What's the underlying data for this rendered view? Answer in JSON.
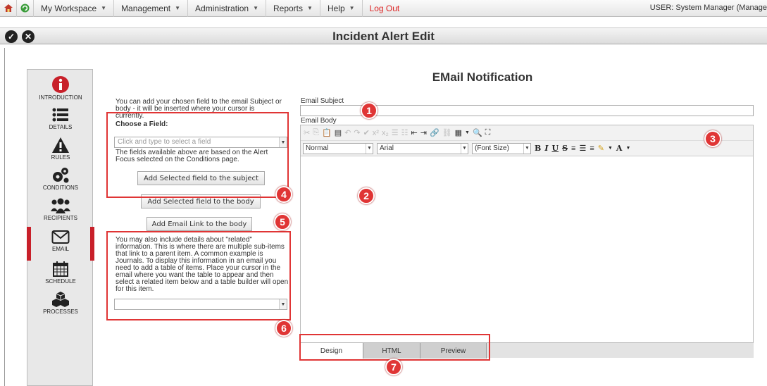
{
  "menubar": {
    "items": [
      "My Workspace",
      "Management",
      "Administration",
      "Reports",
      "Help"
    ],
    "logout": "Log Out",
    "user": "USER: System Manager (Manage"
  },
  "titlebar": {
    "title": "Incident Alert Edit"
  },
  "sidebar": {
    "steps": [
      "INTRODUCTION",
      "DETAILS",
      "RULES",
      "CONDITIONS",
      "RECIPIENTS",
      "EMAIL",
      "SCHEDULE",
      "PROCESSES"
    ],
    "active": "EMAIL"
  },
  "main": {
    "section_title": "EMail Notification",
    "help_intro": "You can add your chosen field to the email Subject or body - it will be inserted where your cursor is currently.",
    "choose_label": "Choose a Field:",
    "field_placeholder": "Click and type to select a field",
    "fields_note": "The fields available above are based on the Alert Focus selected on the Conditions page.",
    "btn_subject": "Add Selected field to the subject",
    "btn_body": "Add Selected field to the body",
    "btn_link": "Add Email Link to the body",
    "related_note": "You may also include details about \"related\" information. This is where there are multiple sub-items that link to a parent item. A common example is Journals. To display this information in an email you need to add a table of items. Place your cursor in the email where you want the table to appear and then select a related item below and a table builder will open for this item.",
    "email_subject_label": "Email Subject",
    "email_body_label": "Email Body",
    "editor": {
      "format": "Normal",
      "font": "Arial",
      "size": "(Font Size)"
    },
    "tabs": [
      "Design",
      "HTML",
      "Preview"
    ]
  },
  "annotations": [
    "1",
    "2",
    "3",
    "4",
    "5",
    "6",
    "7"
  ],
  "colors": {
    "annotation": "#e03535",
    "active_step": "#c8202a",
    "logout": "#dd2222"
  }
}
